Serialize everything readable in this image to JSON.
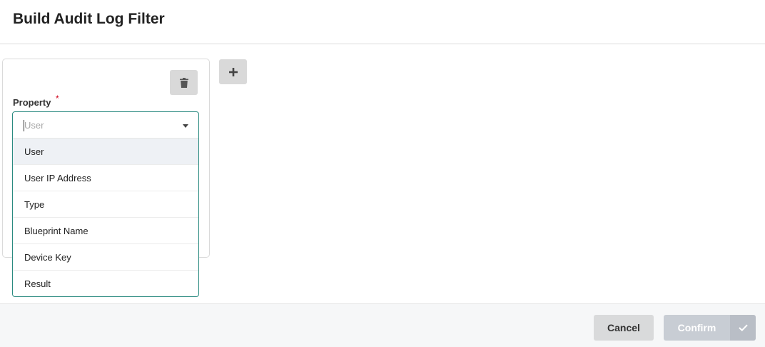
{
  "modal": {
    "title": "Build Audit Log Filter"
  },
  "filter": {
    "property_label": "Property",
    "required_mark": "*",
    "delete_icon": "trash-icon",
    "add_icon": "plus-icon",
    "select": {
      "placeholder": "User",
      "value": "",
      "options": [
        "User",
        "User IP Address",
        "Type",
        "Blueprint Name",
        "Device Key",
        "Result"
      ],
      "highlighted": "User"
    }
  },
  "footer": {
    "cancel_label": "Cancel",
    "confirm_label": "Confirm",
    "confirm_icon": "check-icon"
  },
  "colors": {
    "accent_border": "#2a8a80",
    "required": "#d0021b",
    "button_gray": "#d9d9d9",
    "confirm_disabled": "#c8cdd4"
  }
}
